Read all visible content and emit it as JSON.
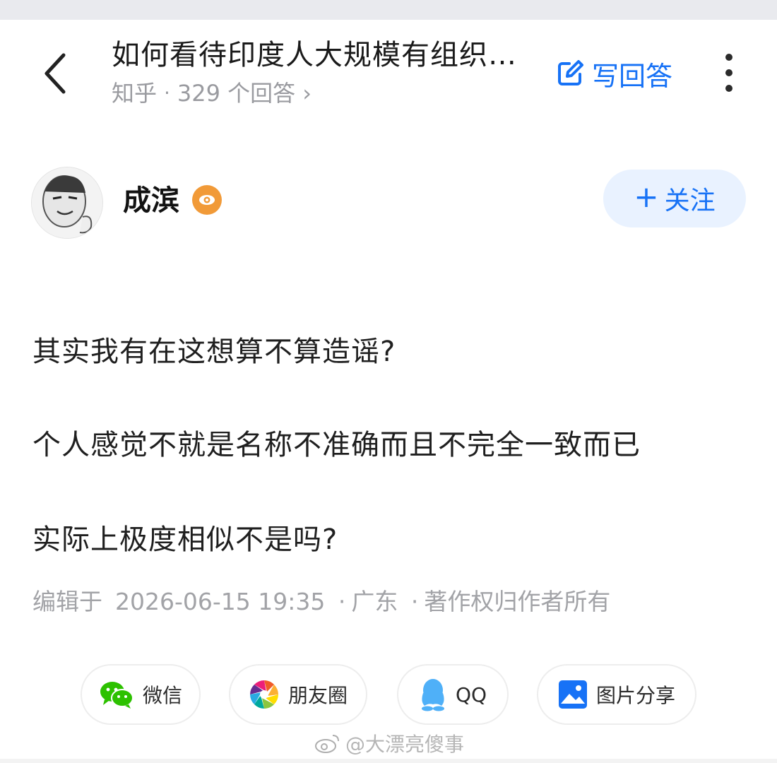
{
  "header": {
    "back_icon": "chevron-left-icon",
    "question_title": "如何看待印度人大规模有组织…",
    "source": "知乎",
    "separator": "·",
    "answer_count": "329 个回答",
    "meta_chevron": "›",
    "write_answer_label": "写回答",
    "write_icon": "edit-icon",
    "more_icon": "more-vertical-icon"
  },
  "author": {
    "name": "成滨",
    "badge_icon": "eye-badge-icon",
    "follow_plus": "+",
    "follow_label": "关注"
  },
  "answer": {
    "paragraphs": [
      "其实我有在这想算不算造谣?",
      "个人感觉不就是名称不准确而且不完全一致而已",
      "实际上极度相似不是吗?"
    ],
    "edit_prefix": "编辑于",
    "edit_time": "2026-06-15 19:35",
    "location": "广东",
    "copyright": "著作权归作者所有",
    "dot": "·"
  },
  "share": {
    "wechat": "微信",
    "moments": "朋友圈",
    "qq": "QQ",
    "image_share": "图片分享"
  },
  "watermark": {
    "text": "@大漂亮傻事"
  },
  "colors": {
    "accent": "#1772f6",
    "follow_bg": "#e9f2ff",
    "meta_gray": "#9a9ba0",
    "badge_orange": "#f19a38",
    "wechat_green": "#2dc100",
    "qq_blue": "#4fb0f8"
  }
}
